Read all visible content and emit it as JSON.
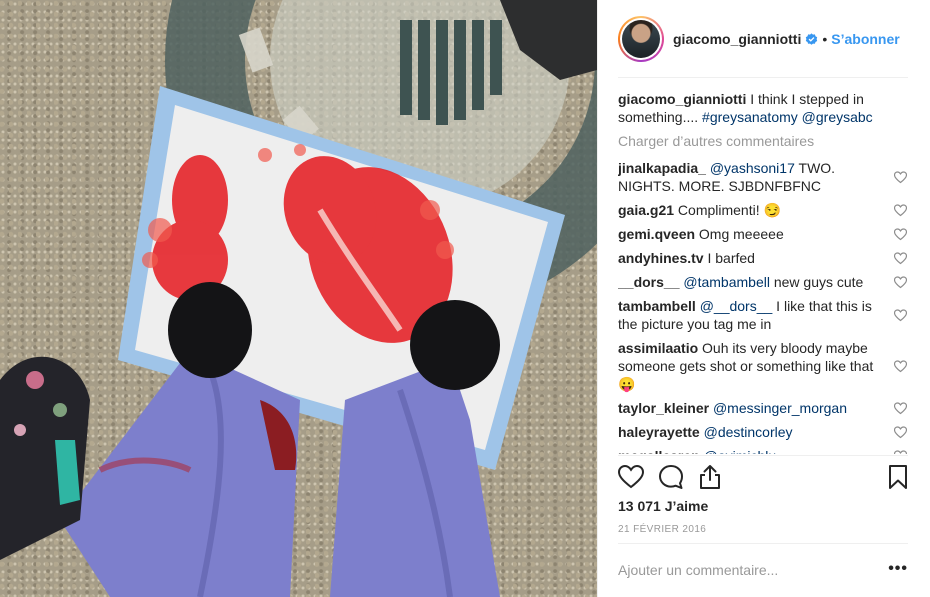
{
  "post": {
    "username": "giacomo_gianniotti",
    "verified": true,
    "separator": "•",
    "follow_label": "S’abonner",
    "caption": {
      "username": "giacomo_gianniotti",
      "text": "I think I stepped in something.... ",
      "tags": [
        "#greysanatomy",
        "@greysabc"
      ]
    },
    "load_more_label": "Charger d’autres commentaires",
    "comments": [
      {
        "username": "jinalkapadia_",
        "mention": "@yashsoni17",
        "text": " TWO. NIGHTS. MORE. SJBDNFBFNC"
      },
      {
        "username": "gaia.g21",
        "mention": "",
        "text": "Complimenti! 😏"
      },
      {
        "username": "gemi.qveen",
        "mention": "",
        "text": "Omg meeeee"
      },
      {
        "username": "andyhines.tv",
        "mention": "",
        "text": "I barfed"
      },
      {
        "username": "__dors__",
        "mention": "@tambambell",
        "text": " new guys cute"
      },
      {
        "username": "tambambell",
        "mention": "@__dors__",
        "text": " I like that this is the picture you tag me in"
      },
      {
        "username": "assimilaatio",
        "mention": "",
        "text": "Ouh its very bloody maybe someone gets shot or something like that 😛"
      },
      {
        "username": "taylor_kleiner",
        "mention": "@messinger_morgan",
        "text": ""
      },
      {
        "username": "haleyrayette",
        "mention": "@destincorley",
        "text": ""
      },
      {
        "username": "mcgallcaren",
        "mention": "@avimichlu",
        "text": ""
      }
    ],
    "likes": "13 071 J’aime",
    "date": "21 FÉVRIER 2016",
    "add_comment_placeholder": "Ajouter un commentaire...",
    "more_label": "•••",
    "icons": {
      "like": "heart-icon",
      "comment": "comment-icon",
      "share": "share-icon",
      "save": "bookmark-icon",
      "verified": "verified-badge-icon",
      "comment_like": "heart-icon"
    },
    "colors": {
      "accent": "#3897f0",
      "mention": "#003569",
      "muted": "#999999",
      "text": "#262626",
      "verified": "#3897f0"
    }
  }
}
